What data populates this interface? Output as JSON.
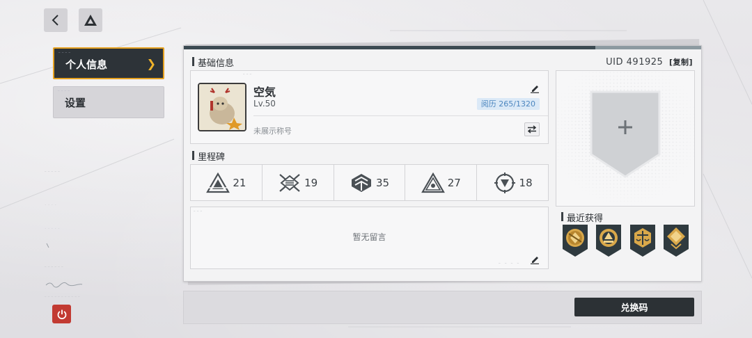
{
  "menu": {
    "items": [
      {
        "label": "个人信息",
        "active": true
      },
      {
        "label": "设置",
        "active": false
      }
    ]
  },
  "panel": {
    "basic_info_title": "基础信息",
    "uid_label": "UID",
    "uid_value": "491925",
    "copy_label": "[复制]"
  },
  "profile": {
    "username": "空気",
    "level": "Lv.50",
    "experience_label": "阅历",
    "experience_value": "265/1320",
    "title_placeholder": "未展示称号"
  },
  "milestones": {
    "title": "里程碑",
    "items": [
      {
        "icon": "triangle-emblem-icon",
        "value": "21"
      },
      {
        "icon": "crossed-emblem-icon",
        "value": "19"
      },
      {
        "icon": "chevron-emblem-icon",
        "value": "35"
      },
      {
        "icon": "pyramid-emblem-icon",
        "value": "27"
      },
      {
        "icon": "target-emblem-icon",
        "value": "18"
      }
    ]
  },
  "message": {
    "empty_text": "暂无留言"
  },
  "recent": {
    "title": "最近获得",
    "medals": [
      "medal-1",
      "medal-2",
      "medal-3",
      "medal-4"
    ]
  },
  "redeem_button_label": "兑换码",
  "colors": {
    "accent": "#e6a11f",
    "dark": "#2d3338",
    "exp_text": "#4c86bf",
    "exp_bg": "#dbe9f7",
    "power": "#c23a32"
  }
}
